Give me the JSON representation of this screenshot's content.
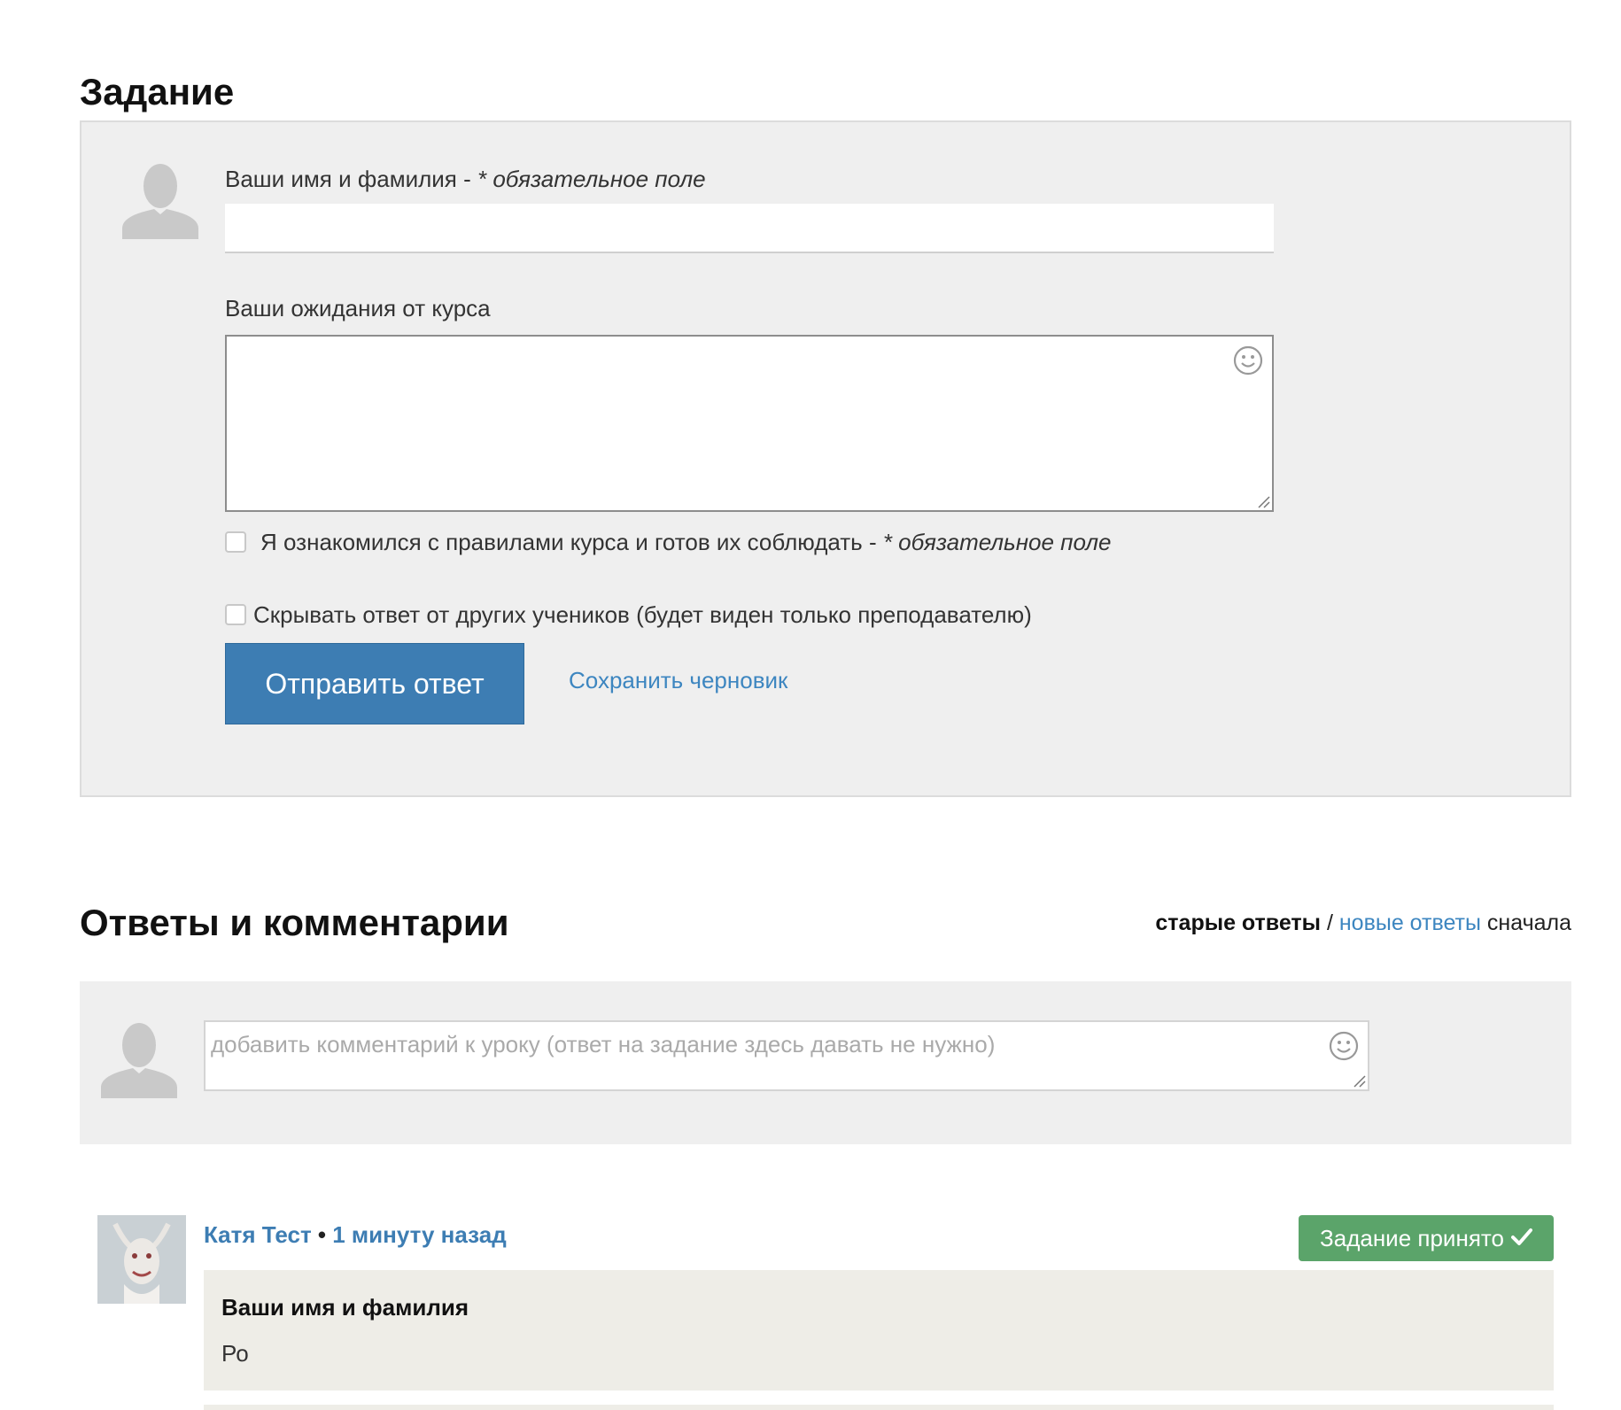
{
  "task": {
    "title": "Задание",
    "name_label": "Ваши имя и фамилия - ",
    "name_required": "* обязательное поле",
    "name_value": "",
    "expectations_label": "Ваши ожидания от курса",
    "expectations_value": "",
    "rules_label": "Я ознакомился с правилами курса и готов их соблюдать - ",
    "rules_required": "* обязательное поле",
    "hide_label": "Скрывать ответ от других учеников (будет виден только преподавателю)",
    "submit_label": "Отправить ответ",
    "draft_label": "Сохранить черновик"
  },
  "answers": {
    "title": "Ответы и комментарии",
    "sort_active": "старые ответы",
    "sort_sep": " / ",
    "sort_link": "новые ответы",
    "sort_suffix": " сначала",
    "comment_placeholder": "добавить комментарий к уроку (ответ на задание здесь давать не нужно)"
  },
  "answer_item": {
    "author": "Катя Тест",
    "separator": " • ",
    "time": "1 минуту назад",
    "status": "Задание принято",
    "status_color": "#5ba46a",
    "field_title": "Ваши имя и фамилия",
    "field_value": "Ро"
  },
  "colors": {
    "accent": "#3d7db3",
    "link": "#3d86c0",
    "panel": "#efefef"
  }
}
